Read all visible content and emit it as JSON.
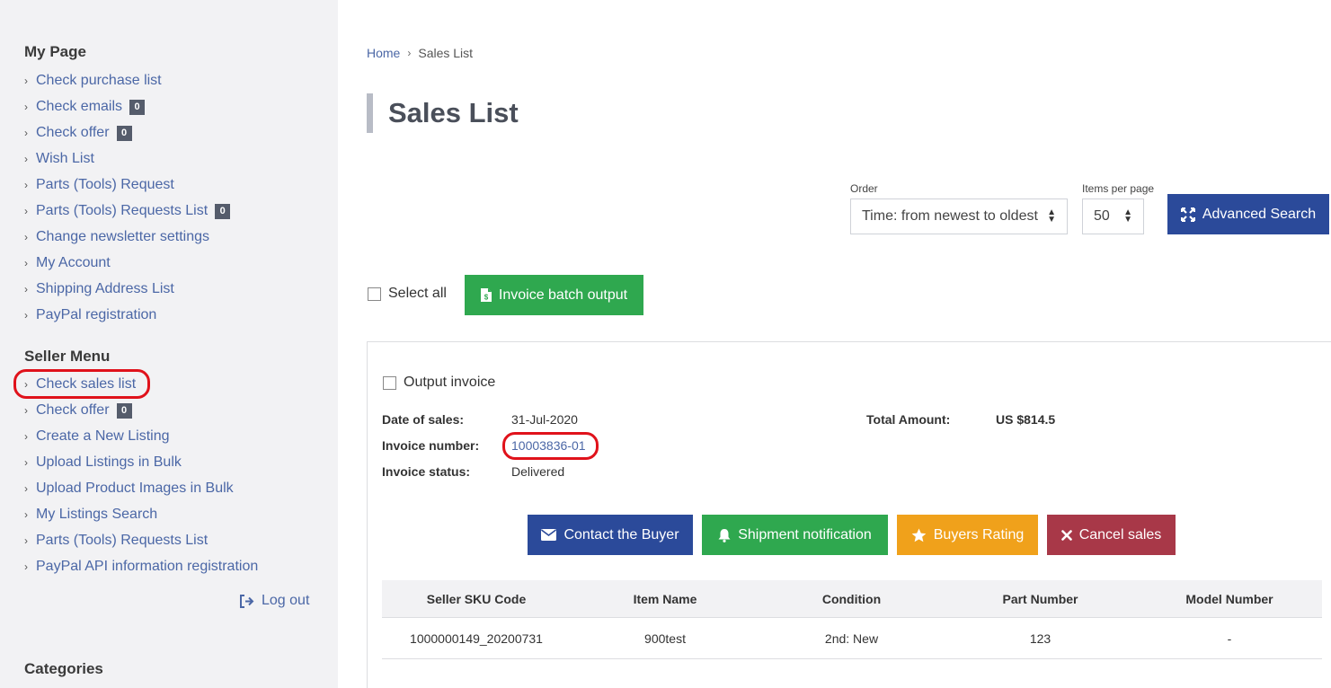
{
  "sidebar": {
    "my_page": {
      "heading": "My Page",
      "items": [
        {
          "label": "Check purchase list",
          "badge": null
        },
        {
          "label": "Check emails",
          "badge": "0"
        },
        {
          "label": "Check offer",
          "badge": "0"
        },
        {
          "label": "Wish List",
          "badge": null
        },
        {
          "label": "Parts (Tools) Request",
          "badge": null
        },
        {
          "label": "Parts (Tools) Requests List",
          "badge": "0"
        },
        {
          "label": "Change newsletter settings",
          "badge": null
        },
        {
          "label": "My Account",
          "badge": null
        },
        {
          "label": "Shipping Address List",
          "badge": null
        },
        {
          "label": "PayPal registration",
          "badge": null
        }
      ]
    },
    "seller_menu": {
      "heading": "Seller Menu",
      "items": [
        {
          "label": "Check sales list",
          "badge": null
        },
        {
          "label": "Check offer",
          "badge": "0"
        },
        {
          "label": "Create a New Listing",
          "badge": null
        },
        {
          "label": "Upload Listings in Bulk",
          "badge": null
        },
        {
          "label": "Upload Product Images in Bulk",
          "badge": null
        },
        {
          "label": "My Listings Search",
          "badge": null
        },
        {
          "label": "Parts (Tools) Requests List",
          "badge": null
        },
        {
          "label": "PayPal API information registration",
          "badge": null
        }
      ]
    },
    "logout_label": "Log out",
    "categories_heading": "Categories"
  },
  "breadcrumb": {
    "home": "Home",
    "current": "Sales List"
  },
  "page_title": "Sales List",
  "filters": {
    "order_label": "Order",
    "order_value": "Time: from newest to oldest",
    "per_page_label": "Items per page",
    "per_page_value": "50",
    "advanced_search_label": "Advanced Search"
  },
  "batch": {
    "select_all_label": "Select all",
    "invoice_batch_label": "Invoice batch output"
  },
  "sale": {
    "output_invoice_label": "Output invoice",
    "date_label": "Date of sales:",
    "date_value": "31-Jul-2020",
    "invoice_number_label": "Invoice number:",
    "invoice_number_value": "10003836-01",
    "invoice_status_label": "Invoice status:",
    "invoice_status_value": "Delivered",
    "total_label": "Total Amount:",
    "total_value": "US $814.5",
    "actions": {
      "contact": "Contact the Buyer",
      "shipment": "Shipment notification",
      "rating": "Buyers Rating",
      "cancel": "Cancel sales"
    },
    "table": {
      "headers": [
        "Seller SKU Code",
        "Item Name",
        "Condition",
        "Part Number",
        "Model Number"
      ],
      "rows": [
        [
          "1000000149_20200731",
          "900test",
          "2nd: New",
          "123",
          "-"
        ]
      ]
    }
  },
  "colors": {
    "link": "#4b67a6",
    "blue_button": "#2b4a9a",
    "green_button": "#2fa84f",
    "orange_button": "#f0a11b",
    "red_button": "#a83848",
    "highlight": "#e0121b"
  }
}
